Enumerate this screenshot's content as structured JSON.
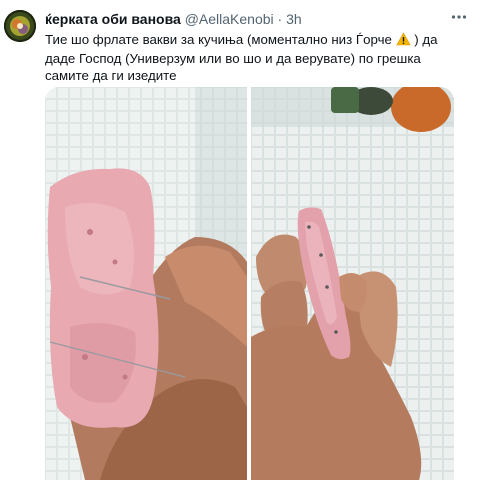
{
  "tweet": {
    "author_name": "ќерката оби ванова",
    "author_handle": "@AellaKenobi",
    "separator": "·",
    "time": "3h",
    "more_icon": "more-horizontal-icon",
    "text_part1": "Тие шо фрлате вакви за кучиња (моментално низ Ѓорче ",
    "warning_icon": "warning-icon",
    "text_part2": " ) да даде Господ (Универзум или во шо и да верувате) по грешка самите да ги изедите"
  },
  "media": {
    "photos": [
      {
        "name": "photo-left",
        "icon": "photo"
      },
      {
        "name": "photo-right",
        "icon": "photo"
      }
    ]
  },
  "colors": {
    "text": "#0f1419",
    "secondary": "#536471",
    "warning_yellow": "#f4b400"
  }
}
